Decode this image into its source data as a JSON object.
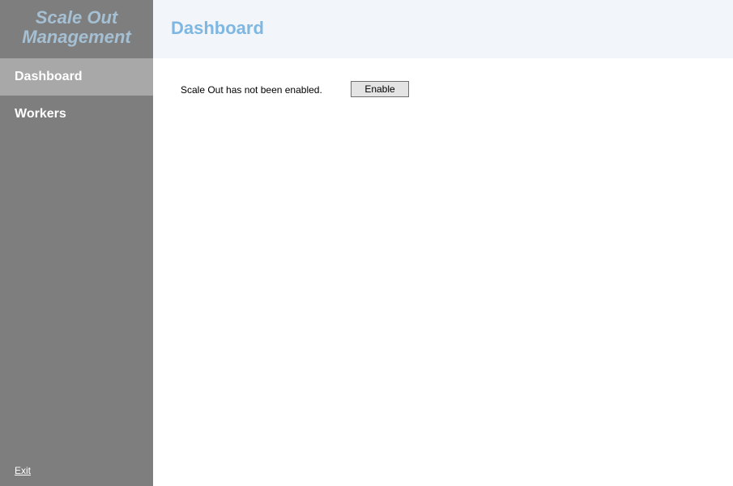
{
  "sidebar": {
    "title": "Scale Out Management",
    "items": [
      {
        "label": "Dashboard",
        "active": true
      },
      {
        "label": "Workers",
        "active": false
      }
    ],
    "exit_label": "Exit"
  },
  "header": {
    "title": "Dashboard"
  },
  "main": {
    "status_text": "Scale Out has not been enabled.",
    "enable_button_label": "Enable"
  }
}
